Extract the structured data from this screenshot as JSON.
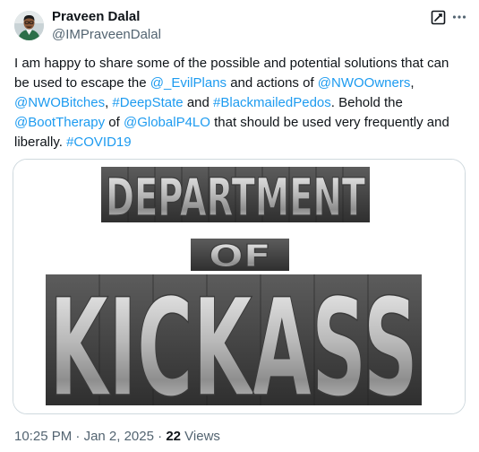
{
  "author": {
    "name": "Praveen Dalal",
    "handle": "@IMPraveenDalal"
  },
  "actions": {
    "grok_icon": "grok-icon",
    "more_icon": "more-icon"
  },
  "tweet_text": {
    "t1": "I am happy to share some of the possible and potential solutions that can be used to escape the ",
    "m1": "@_EvilPlans",
    "t2": " and actions of ",
    "m2": "@NWOOwners",
    "t3": ", ",
    "m3": "@NWOBitches",
    "t4": ", ",
    "h1": "#DeepState",
    "t5": " and ",
    "h2": "#BlackmailedPedos",
    "t6": ". Behold the ",
    "m4": "@BootTherapy",
    "t7": " of ",
    "m5": "@GlobalP4LO",
    "t8": " that should be used very frequently and liberally. ",
    "h3": "#COVID19"
  },
  "media": {
    "line1": "DEPARTMENT",
    "line2": "OF",
    "line3": "KICKASS"
  },
  "meta": {
    "time": "10:25 PM",
    "sep1": " · ",
    "date": "Jan 2, 2025",
    "sep2": " · ",
    "views_count": "22",
    "views_label": " Views"
  },
  "colors": {
    "link": "#1d9bf0",
    "text": "#0f1419",
    "secondary": "#536471",
    "border": "#cfd9de"
  }
}
